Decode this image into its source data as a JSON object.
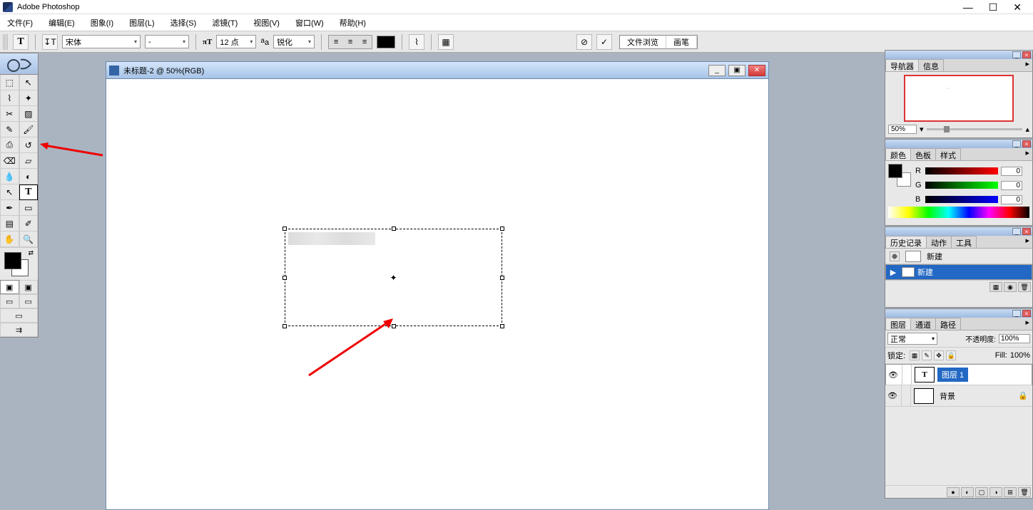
{
  "app": {
    "title": "Adobe Photoshop"
  },
  "menu": {
    "file": "文件(F)",
    "edit": "编辑(E)",
    "image": "图象(I)",
    "layer": "图层(L)",
    "select": "选择(S)",
    "filter": "滤镜(T)",
    "view": "视图(V)",
    "window": "窗口(W)",
    "help": "帮助(H)"
  },
  "options": {
    "font": "宋体",
    "style": "-",
    "size": "12 点",
    "aa": "锐化",
    "palette_tab1": "文件浏览",
    "palette_tab2": "画笔"
  },
  "doc": {
    "title": "未标题-2 @ 50%(RGB)"
  },
  "navigator": {
    "tab1": "导航器",
    "tab2": "信息",
    "zoom": "50%"
  },
  "color": {
    "tab1": "颜色",
    "tab2": "色板",
    "tab3": "样式",
    "r_lbl": "R",
    "g_lbl": "G",
    "b_lbl": "B",
    "r": "0",
    "g": "0",
    "b": "0"
  },
  "history": {
    "tab1": "历史记录",
    "tab2": "动作",
    "tab3": "工具",
    "snap_name": "新建",
    "step1": "新建"
  },
  "layers": {
    "tab1": "图层",
    "tab2": "通道",
    "tab3": "路径",
    "mode": "正常",
    "opacity_lbl": "不透明度:",
    "opacity": "100%",
    "lock_lbl": "锁定:",
    "fill_lbl": "Fill:",
    "fill": "100%",
    "layer1": "图层 1",
    "bg": "背景"
  }
}
